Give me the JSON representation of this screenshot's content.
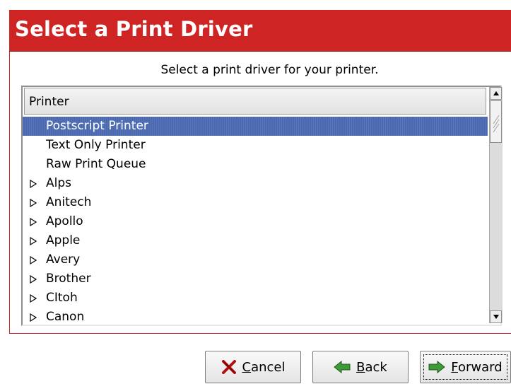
{
  "header": {
    "title": "Select a Print Driver"
  },
  "subtitle": "Select a print driver for your printer.",
  "list": {
    "column_header": "Printer",
    "selected_index": 0,
    "rows": [
      {
        "label": "Postscript Printer",
        "expandable": false
      },
      {
        "label": "Text Only Printer",
        "expandable": false
      },
      {
        "label": "Raw Print Queue",
        "expandable": false
      },
      {
        "label": "Alps",
        "expandable": true
      },
      {
        "label": "Anitech",
        "expandable": true
      },
      {
        "label": "Apollo",
        "expandable": true
      },
      {
        "label": "Apple",
        "expandable": true
      },
      {
        "label": "Avery",
        "expandable": true
      },
      {
        "label": "Brother",
        "expandable": true
      },
      {
        "label": "CItoh",
        "expandable": true
      },
      {
        "label": "Canon",
        "expandable": true
      }
    ]
  },
  "buttons": {
    "cancel": {
      "accel": "C",
      "rest": "ancel",
      "icon": "x-icon"
    },
    "back": {
      "accel": "B",
      "rest": "ack",
      "icon": "left-arrow-icon"
    },
    "forward": {
      "accel": "F",
      "rest": "orward",
      "icon": "right-arrow-icon"
    }
  },
  "colors": {
    "header_bg": "#cf2424",
    "selection": "#4b69b0",
    "arrow_green": "#3f9a38"
  }
}
